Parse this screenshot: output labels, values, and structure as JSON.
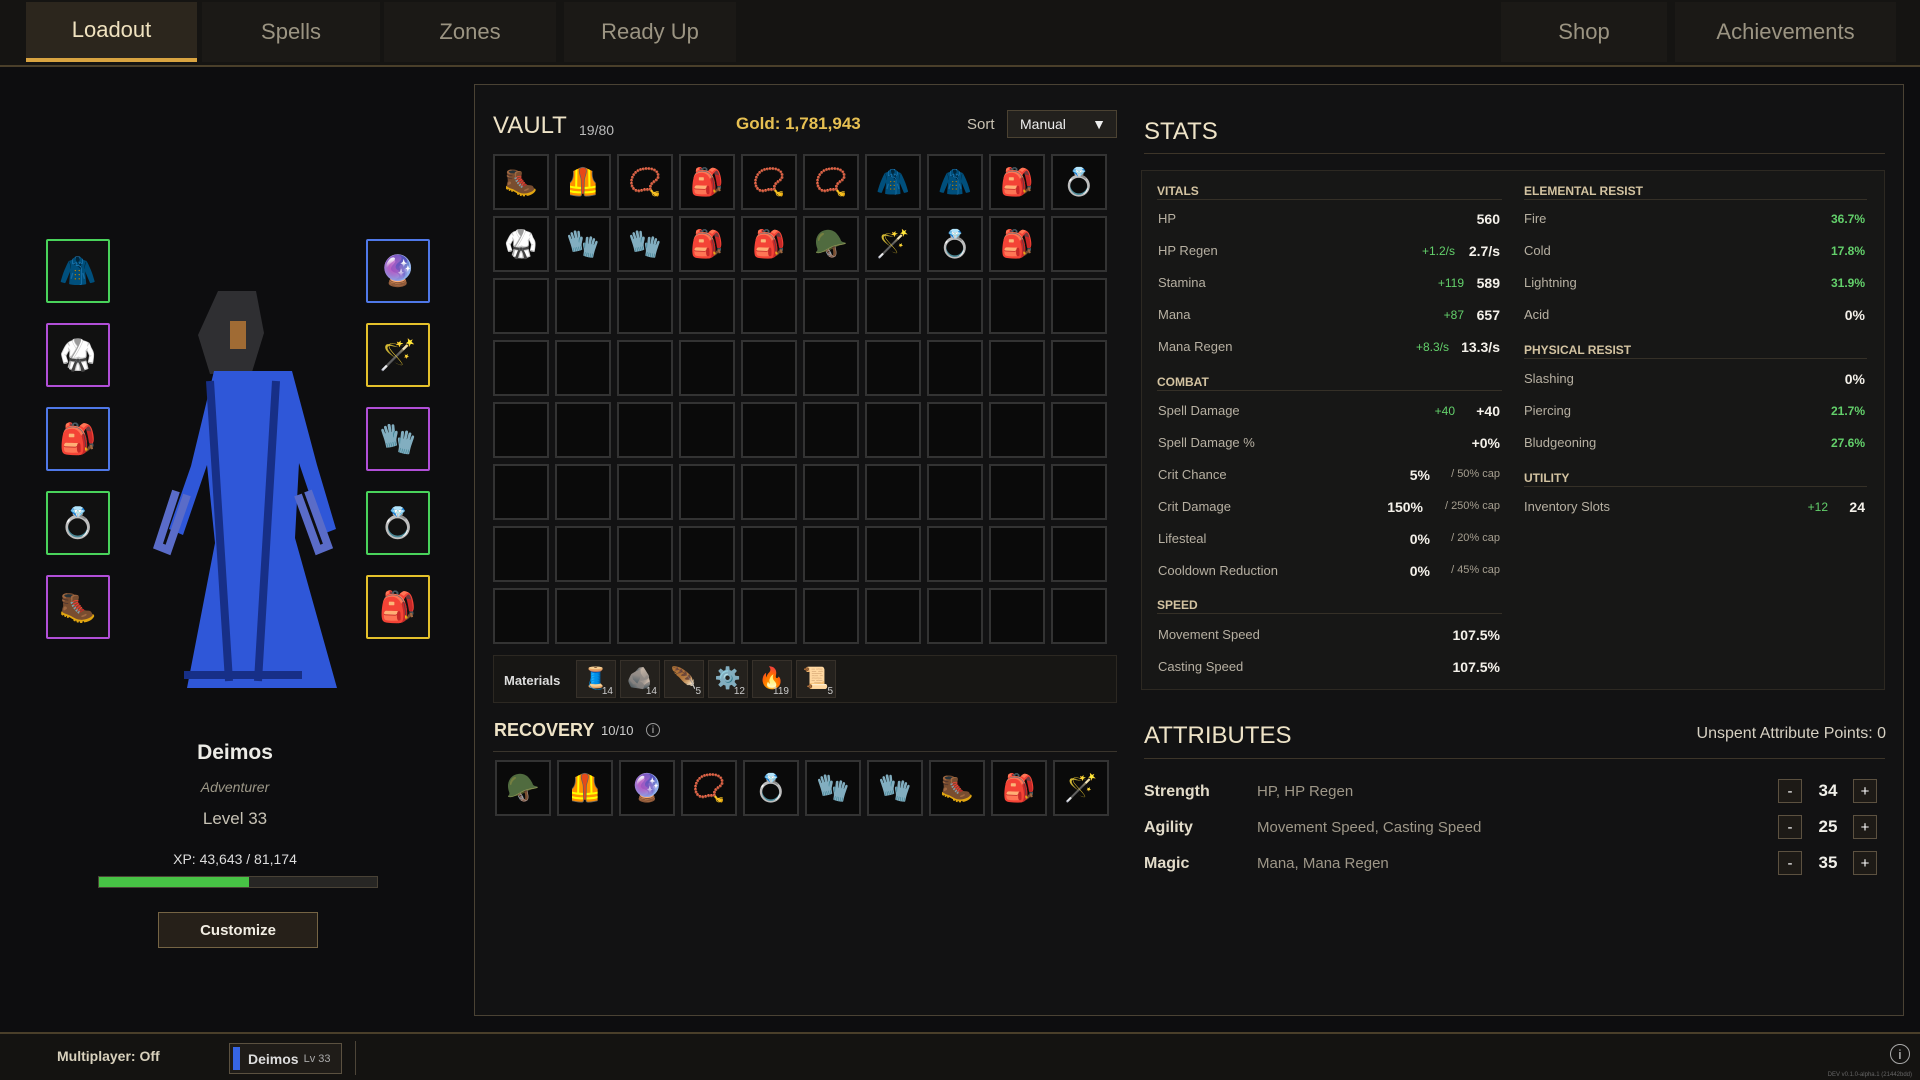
{
  "tabs": {
    "loadout": "Loadout",
    "spells": "Spells",
    "zones": "Zones",
    "ready": "Ready Up",
    "shop": "Shop",
    "achievements": "Achievements"
  },
  "character": {
    "name": "Deimos",
    "class": "Adventurer",
    "level": "Level 33",
    "xp": "XP: 43,643 / 81,174",
    "xp_progress": 0.538,
    "customize": "Customize"
  },
  "vault": {
    "title": "VAULT",
    "count": "19/80",
    "gold": "Gold: 1,781,943",
    "sort_label": "Sort",
    "sort_value": "Manual"
  },
  "materials": {
    "label": "Materials",
    "counts": [
      "14",
      "14",
      "5",
      "12",
      "119",
      "5"
    ]
  },
  "recovery": {
    "title": "RECOVERY",
    "count": "10/10",
    "info": "i"
  },
  "stats": {
    "title": "STATS",
    "vitals": {
      "title": "VITALS",
      "hp": "HP",
      "hp_value": "560",
      "hp_regen": "HP Regen",
      "hp_regen_bonus": "+1.2/s",
      "hp_regen_value": "2.7/s",
      "stamina": "Stamina",
      "stamina_bonus": "+119",
      "stamina_value": "589",
      "mana": "Mana",
      "mana_bonus": "+87",
      "mana_value": "657",
      "mana_regen": "Mana Regen",
      "mana_regen_bonus": "+8.3/s",
      "mana_regen_value": "13.3/s"
    },
    "combat": {
      "title": "COMBAT",
      "spell_damage": "Spell Damage",
      "spell_damage_bonus": "+40",
      "spell_damage_value": "+40",
      "spell_damage_pct": "Spell Damage %",
      "spell_damage_pct_value": "+0%",
      "crit_chance": "Crit Chance",
      "crit_chance_value": "5%",
      "crit_chance_cap": "/ 50% cap",
      "crit_damage": "Crit Damage",
      "crit_damage_value": "150%",
      "crit_damage_cap": "/ 250% cap",
      "lifesteal": "Lifesteal",
      "lifesteal_value": "0%",
      "lifesteal_cap": "/ 20% cap",
      "cooldown": "Cooldown Reduction",
      "cooldown_value": "0%",
      "cooldown_cap": "/ 45% cap"
    },
    "speed": {
      "title": "SPEED",
      "movement": "Movement Speed",
      "movement_value": "107.5%",
      "casting": "Casting Speed",
      "casting_value": "107.5%"
    },
    "elemental": {
      "title": "ELEMENTAL RESIST",
      "fire": "Fire",
      "fire_value": "36.7%",
      "cold": "Cold",
      "cold_value": "17.8%",
      "lightning": "Lightning",
      "lightning_value": "31.9%",
      "acid": "Acid",
      "acid_value": "0%"
    },
    "physical": {
      "title": "PHYSICAL RESIST",
      "slashing": "Slashing",
      "slashing_value": "0%",
      "piercing": "Piercing",
      "piercing_value": "21.7%",
      "bludgeoning": "Bludgeoning",
      "bludgeoning_value": "27.6%"
    },
    "utility": {
      "title": "UTILITY",
      "inventory": "Inventory Slots",
      "inventory_bonus": "+12",
      "inventory_value": "24"
    }
  },
  "attributes": {
    "title": "ATTRIBUTES",
    "unspent": "Unspent Attribute Points: 0",
    "minus": "-",
    "plus": "+",
    "strength": {
      "name": "Strength",
      "desc": "HP, HP Regen",
      "value": "34"
    },
    "agility": {
      "name": "Agility",
      "desc": "Movement Speed, Casting Speed",
      "value": "25"
    },
    "magic": {
      "name": "Magic",
      "desc": "Mana, Mana Regen",
      "value": "35"
    }
  },
  "bottom": {
    "multiplayer": "Multiplayer: Off",
    "player_name": "Deimos",
    "player_level": "Lv 33",
    "info": "i",
    "version": "DEV v0.1.0-alpha.1 (21442bdd)"
  }
}
